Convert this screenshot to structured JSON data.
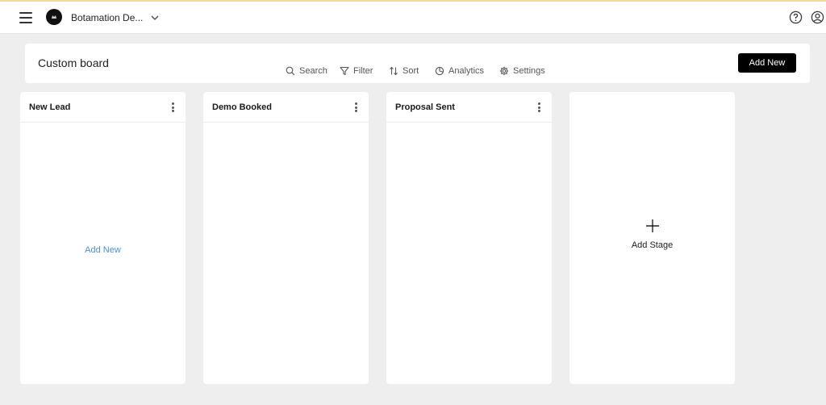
{
  "topbar": {
    "workspace_name": "Botamation De...",
    "icons": [
      "menu-icon",
      "workspace-logo",
      "chevron-down-icon",
      "help-icon",
      "account-icon"
    ]
  },
  "board": {
    "title": "Custom board",
    "toolbar": {
      "search": "Search",
      "filter": "Filter",
      "sort": "Sort",
      "analytics": "Analytics",
      "settings": "Settings"
    },
    "add_new_label": "Add New"
  },
  "columns": [
    {
      "title": "New Lead",
      "add_label": "Add New"
    },
    {
      "title": "Demo Booked"
    },
    {
      "title": "Proposal Sent"
    }
  ],
  "add_stage_label": "Add Stage",
  "colors": {
    "background": "#eeeeee",
    "primary_button": "#000000",
    "link": "#4a90e2",
    "top_border_accent": "#f5d79a"
  }
}
